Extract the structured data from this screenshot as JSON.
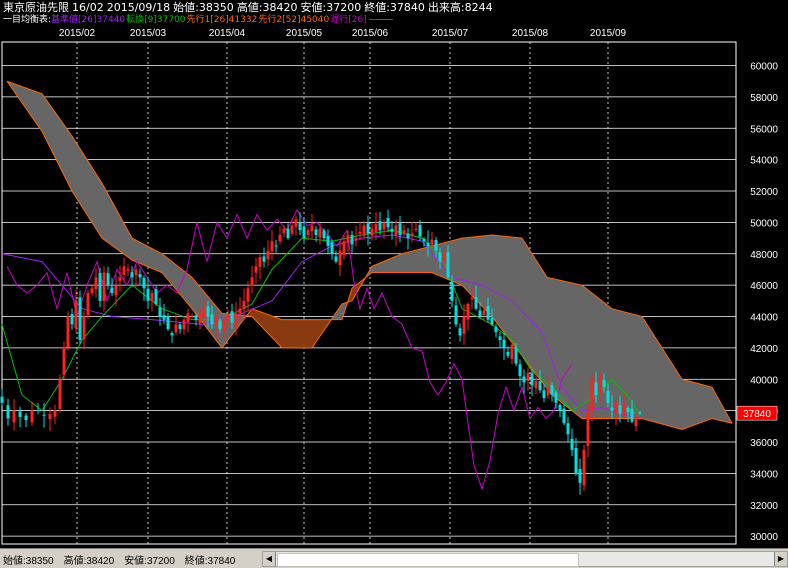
{
  "header": {
    "symbol": "東京原油先限",
    "contract": "16/02",
    "date": "2015/09/18",
    "open_label": "始値:38350",
    "high_label": "高値:38420",
    "low_label": "安値:37200",
    "close_label": "終値:37840",
    "volume_label": "出来高:8244"
  },
  "indicator_legend": {
    "title": "一目均衡表:",
    "items": [
      {
        "text": "基準値[26]37440",
        "color": "#a020f0"
      },
      {
        "text": "転換[9]37700",
        "color": "#00c000"
      },
      {
        "text": "先行1[26]41332",
        "color": "#ff6600"
      },
      {
        "text": "先行2[52]45040",
        "color": "#ff6600"
      },
      {
        "text": "遅行[26]",
        "color": "#cc00cc"
      }
    ]
  },
  "footer": {
    "open": "始値:38350",
    "high": "高値:38420",
    "low": "安値:37200",
    "close": "終値:37840"
  },
  "colors": {
    "background": "#000000",
    "up_candle": "#ff2020",
    "down_candle": "#00e0e0",
    "kijun": "#a020f0",
    "tenkan": "#00c000",
    "senkou": "#ff6600",
    "chikou": "#cc00cc",
    "cloud_bear": "#666666",
    "cloud_bull": "#8a3a10",
    "price_tag_bg": "#ff0000"
  },
  "chart_data": {
    "type": "candlestick",
    "title": "東京原油先限 16/02",
    "y_ticks": [
      30000,
      32000,
      34000,
      36000,
      38000,
      40000,
      42000,
      44000,
      46000,
      48000,
      50000,
      52000,
      54000,
      56000,
      58000,
      60000
    ],
    "ylim": [
      29500,
      61500
    ],
    "x_tick_labels": [
      "2015/02",
      "2015/03",
      "2015/04",
      "2015/05",
      "2015/06",
      "2015/07",
      "2015/08",
      "2015/09"
    ],
    "current_price_label": "37840",
    "grid": true,
    "closes": [
      [
        0,
        38500
      ],
      [
        6,
        37500
      ],
      [
        12,
        38000
      ],
      [
        18,
        37600
      ],
      [
        24,
        37400
      ],
      [
        30,
        38000
      ],
      [
        36,
        38000
      ],
      [
        42,
        37700
      ],
      [
        48,
        37800
      ],
      [
        53,
        38000
      ],
      [
        58,
        40000
      ],
      [
        62,
        42000
      ],
      [
        66,
        44000
      ],
      [
        70,
        43500
      ],
      [
        74,
        45000
      ],
      [
        78,
        42500
      ],
      [
        82,
        44000
      ],
      [
        86,
        45500
      ],
      [
        90,
        45800
      ],
      [
        94,
        46500
      ],
      [
        98,
        45000
      ],
      [
        102,
        46800
      ],
      [
        106,
        46000
      ],
      [
        110,
        45500
      ],
      [
        114,
        46000
      ],
      [
        118,
        46500
      ],
      [
        122,
        47200
      ],
      [
        126,
        47000
      ],
      [
        130,
        46500
      ],
      [
        134,
        47000
      ],
      [
        138,
        46500
      ],
      [
        142,
        45800
      ],
      [
        146,
        45000
      ],
      [
        150,
        45500
      ],
      [
        154,
        44800
      ],
      [
        158,
        44000
      ],
      [
        162,
        43800
      ],
      [
        166,
        43200
      ],
      [
        170,
        42800
      ],
      [
        174,
        43500
      ],
      [
        178,
        43200
      ],
      [
        182,
        43800
      ],
      [
        186,
        44200
      ],
      [
        190,
        44000
      ],
      [
        194,
        43800
      ],
      [
        198,
        44200
      ],
      [
        202,
        44500
      ],
      [
        206,
        44000
      ],
      [
        210,
        43500
      ],
      [
        214,
        44000
      ],
      [
        218,
        43200
      ],
      [
        222,
        43800
      ],
      [
        226,
        44100
      ],
      [
        230,
        43600
      ],
      [
        234,
        44200
      ],
      [
        238,
        44500
      ],
      [
        242,
        45000
      ],
      [
        246,
        45800
      ],
      [
        250,
        46500
      ],
      [
        254,
        47200
      ],
      [
        258,
        47800
      ],
      [
        262,
        47500
      ],
      [
        266,
        48200
      ],
      [
        270,
        48800
      ],
      [
        274,
        48500
      ],
      [
        278,
        49200
      ],
      [
        282,
        49600
      ],
      [
        286,
        49000
      ],
      [
        290,
        49800
      ],
      [
        294,
        50200
      ],
      [
        298,
        49500
      ],
      [
        302,
        49000
      ],
      [
        306,
        49500
      ],
      [
        310,
        49800
      ],
      [
        314,
        49200
      ],
      [
        318,
        49600
      ],
      [
        322,
        49000
      ],
      [
        326,
        48500
      ],
      [
        330,
        48000
      ],
      [
        334,
        47500
      ],
      [
        338,
        48200
      ],
      [
        342,
        48800
      ],
      [
        346,
        49200
      ],
      [
        350,
        48600
      ],
      [
        354,
        49000
      ],
      [
        358,
        49400
      ],
      [
        362,
        49800
      ],
      [
        366,
        49300
      ],
      [
        370,
        49600
      ],
      [
        374,
        49900
      ],
      [
        378,
        49500
      ],
      [
        382,
        50000
      ],
      [
        386,
        49700
      ],
      [
        390,
        49400
      ],
      [
        394,
        49800
      ],
      [
        398,
        49200
      ],
      [
        402,
        49500
      ],
      [
        406,
        49000
      ],
      [
        410,
        49300
      ],
      [
        414,
        49600
      ],
      [
        418,
        49100
      ],
      [
        422,
        48800
      ],
      [
        426,
        48500
      ],
      [
        430,
        48900
      ],
      [
        434,
        48200
      ],
      [
        438,
        47500
      ],
      [
        442,
        48000
      ],
      [
        446,
        46500
      ],
      [
        450,
        45000
      ],
      [
        454,
        43500
      ],
      [
        458,
        42800
      ],
      [
        462,
        44000
      ],
      [
        466,
        44800
      ],
      [
        470,
        45200
      ],
      [
        474,
        44500
      ],
      [
        478,
        44000
      ],
      [
        482,
        44400
      ],
      [
        486,
        43800
      ],
      [
        490,
        43500
      ],
      [
        494,
        43000
      ],
      [
        498,
        42500
      ],
      [
        502,
        42000
      ],
      [
        506,
        41500
      ],
      [
        510,
        42200
      ],
      [
        514,
        41000
      ],
      [
        518,
        40200
      ],
      [
        522,
        39800
      ],
      [
        526,
        40400
      ],
      [
        530,
        39600
      ],
      [
        534,
        39900
      ],
      [
        538,
        39300
      ],
      [
        542,
        38800
      ],
      [
        546,
        39500
      ],
      [
        550,
        39000
      ],
      [
        554,
        38500
      ],
      [
        558,
        38000
      ],
      [
        562,
        37200
      ],
      [
        566,
        36500
      ],
      [
        570,
        35500
      ],
      [
        574,
        34000
      ],
      [
        578,
        33400
      ],
      [
        582,
        35500
      ],
      [
        586,
        38000
      ],
      [
        590,
        40000
      ],
      [
        594,
        39000
      ],
      [
        598,
        40200
      ],
      [
        602,
        39500
      ],
      [
        606,
        38500
      ],
      [
        610,
        38000
      ],
      [
        614,
        38500
      ],
      [
        618,
        37800
      ],
      [
        622,
        38400
      ],
      [
        626,
        37900
      ],
      [
        630,
        37300
      ],
      [
        634,
        37600
      ],
      [
        638,
        37840
      ]
    ],
    "kijun_points": [
      [
        0,
        48000
      ],
      [
        40,
        47500
      ],
      [
        60,
        46000
      ],
      [
        80,
        44500
      ],
      [
        110,
        44000
      ],
      [
        150,
        43800
      ],
      [
        200,
        43500
      ],
      [
        240,
        44200
      ],
      [
        270,
        45000
      ],
      [
        300,
        47500
      ],
      [
        330,
        48500
      ],
      [
        360,
        49000
      ],
      [
        390,
        49200
      ],
      [
        420,
        48800
      ],
      [
        450,
        46500
      ],
      [
        480,
        46000
      ],
      [
        510,
        45000
      ],
      [
        540,
        43000
      ],
      [
        560,
        39500
      ],
      [
        580,
        38000
      ],
      [
        600,
        38200
      ],
      [
        638,
        37440
      ]
    ],
    "tenkan_points": [
      [
        0,
        43500
      ],
      [
        20,
        39000
      ],
      [
        40,
        38000
      ],
      [
        60,
        40000
      ],
      [
        80,
        42500
      ],
      [
        100,
        44000
      ],
      [
        130,
        46000
      ],
      [
        160,
        44500
      ],
      [
        190,
        43800
      ],
      [
        220,
        43800
      ],
      [
        250,
        44800
      ],
      [
        270,
        47000
      ],
      [
        300,
        49000
      ],
      [
        330,
        48800
      ],
      [
        360,
        49200
      ],
      [
        390,
        49500
      ],
      [
        420,
        49000
      ],
      [
        440,
        47800
      ],
      [
        460,
        44500
      ],
      [
        490,
        43500
      ],
      [
        510,
        42500
      ],
      [
        530,
        40500
      ],
      [
        550,
        39500
      ],
      [
        570,
        38000
      ],
      [
        590,
        38800
      ],
      [
        610,
        40000
      ],
      [
        625,
        39000
      ],
      [
        638,
        37700
      ]
    ],
    "chikou_points": [
      [
        5,
        47200
      ],
      [
        15,
        46000
      ],
      [
        25,
        45500
      ],
      [
        35,
        46000
      ],
      [
        45,
        46800
      ],
      [
        55,
        44500
      ],
      [
        65,
        46800
      ],
      [
        75,
        44000
      ],
      [
        85,
        46000
      ],
      [
        95,
        47500
      ],
      [
        105,
        45000
      ],
      [
        115,
        47000
      ],
      [
        125,
        46000
      ],
      [
        135,
        47500
      ],
      [
        145,
        46500
      ],
      [
        155,
        45500
      ],
      [
        165,
        46000
      ],
      [
        175,
        45500
      ],
      [
        185,
        47000
      ],
      [
        195,
        50000
      ],
      [
        205,
        47500
      ],
      [
        215,
        50000
      ],
      [
        225,
        49000
      ],
      [
        235,
        50500
      ],
      [
        245,
        49000
      ],
      [
        255,
        50500
      ],
      [
        265,
        49500
      ],
      [
        275,
        50200
      ],
      [
        285,
        49500
      ],
      [
        295,
        50800
      ],
      [
        305,
        49800
      ],
      [
        315,
        50000
      ],
      [
        325,
        49200
      ],
      [
        335,
        48500
      ],
      [
        345,
        49500
      ],
      [
        352,
        46200
      ],
      [
        358,
        44500
      ],
      [
        365,
        45800
      ],
      [
        372,
        44500
      ],
      [
        380,
        45500
      ],
      [
        390,
        44000
      ],
      [
        400,
        43500
      ],
      [
        410,
        42000
      ],
      [
        420,
        41800
      ],
      [
        428,
        39800
      ],
      [
        436,
        39000
      ],
      [
        444,
        39800
      ],
      [
        452,
        41000
      ],
      [
        460,
        40000
      ],
      [
        466,
        37200
      ],
      [
        472,
        34500
      ],
      [
        480,
        33000
      ],
      [
        488,
        34800
      ],
      [
        496,
        37800
      ],
      [
        504,
        39500
      ],
      [
        512,
        38000
      ],
      [
        520,
        39500
      ],
      [
        528,
        37500
      ],
      [
        536,
        38200
      ],
      [
        544,
        37500
      ],
      [
        552,
        38000
      ],
      [
        560,
        40000
      ],
      [
        570,
        41000
      ]
    ],
    "senkou_a_points": [
      [
        5,
        59000
      ],
      [
        40,
        55800
      ],
      [
        70,
        52000
      ],
      [
        100,
        49000
      ],
      [
        130,
        47600
      ],
      [
        160,
        46800
      ],
      [
        190,
        44500
      ],
      [
        220,
        42000
      ],
      [
        250,
        44500
      ],
      [
        280,
        43800
      ],
      [
        310,
        43800
      ],
      [
        340,
        43800
      ],
      [
        350,
        45800
      ],
      [
        370,
        46800
      ],
      [
        400,
        46800
      ],
      [
        430,
        46800
      ],
      [
        460,
        46000
      ],
      [
        490,
        44000
      ],
      [
        520,
        41500
      ],
      [
        550,
        39000
      ],
      [
        580,
        37500
      ],
      [
        610,
        37500
      ],
      [
        640,
        37500
      ],
      [
        680,
        36800
      ],
      [
        710,
        37500
      ],
      [
        730,
        37200
      ]
    ],
    "senkou_b_points": [
      [
        5,
        59000
      ],
      [
        40,
        58200
      ],
      [
        70,
        55500
      ],
      [
        100,
        52500
      ],
      [
        130,
        49000
      ],
      [
        160,
        48000
      ],
      [
        190,
        46500
      ],
      [
        220,
        44200
      ],
      [
        250,
        44000
      ],
      [
        280,
        42000
      ],
      [
        310,
        42000
      ],
      [
        340,
        44800
      ],
      [
        350,
        45000
      ],
      [
        370,
        47200
      ],
      [
        400,
        48000
      ],
      [
        430,
        48500
      ],
      [
        460,
        49000
      ],
      [
        490,
        49200
      ],
      [
        520,
        49000
      ],
      [
        545,
        46500
      ],
      [
        580,
        46000
      ],
      [
        610,
        44500
      ],
      [
        640,
        44000
      ],
      [
        680,
        40000
      ],
      [
        710,
        39500
      ],
      [
        730,
        37200
      ]
    ]
  }
}
